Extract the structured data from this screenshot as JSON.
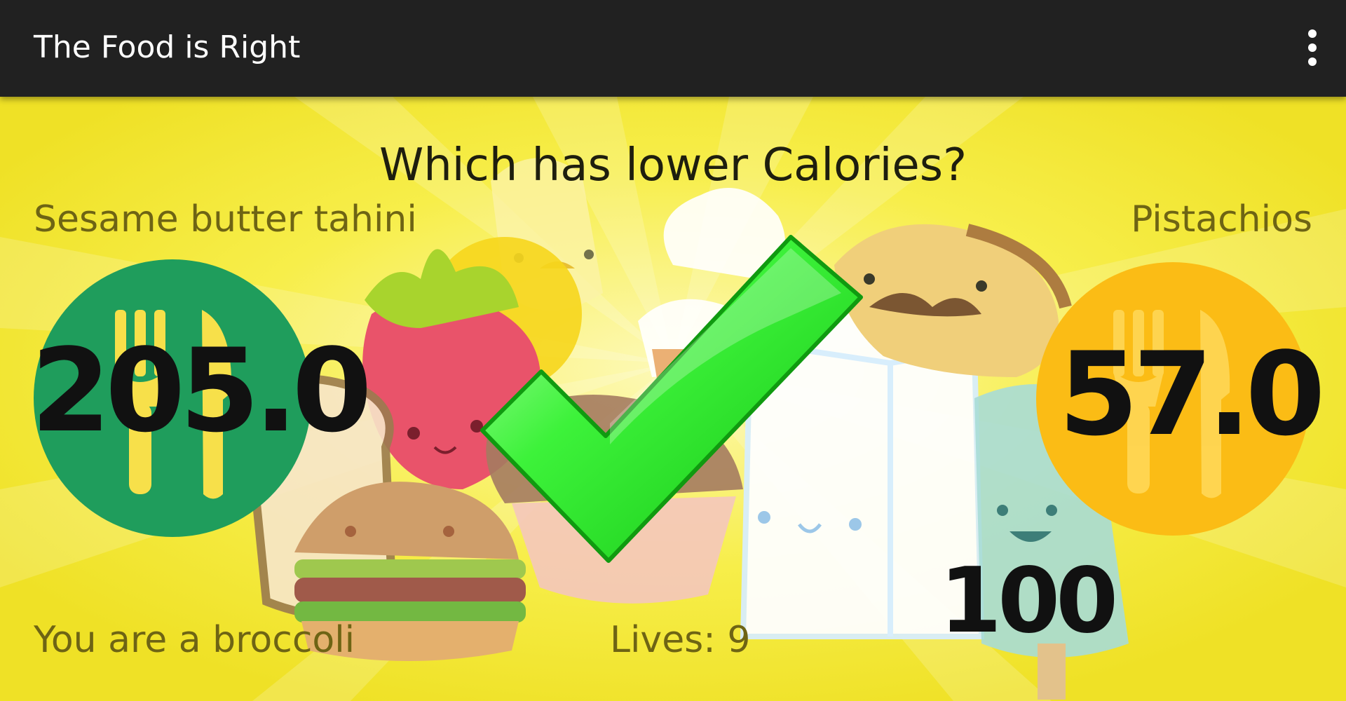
{
  "app_bar": {
    "title": "The Food is Right",
    "overflow_icon": "overflow-menu-icon"
  },
  "game": {
    "question": "Which has lower Calories?",
    "left_food": {
      "name": "Sesame butter tahini",
      "value": "205.0",
      "color": "#1f9d5c",
      "icon": "fork-knife-icon"
    },
    "right_food": {
      "name": "Pistachios",
      "value": "57.0",
      "color": "#fbbc15",
      "icon": "fork-knife-icon"
    },
    "result_icon": "checkmark-icon",
    "result_color": "#22e01e",
    "score": "100",
    "rank_text": "You are a broccoli",
    "lives_text": "Lives: 9"
  },
  "colors": {
    "app_bar": "#212121",
    "background": "#f2e62a",
    "label_text": "#6e6414"
  }
}
